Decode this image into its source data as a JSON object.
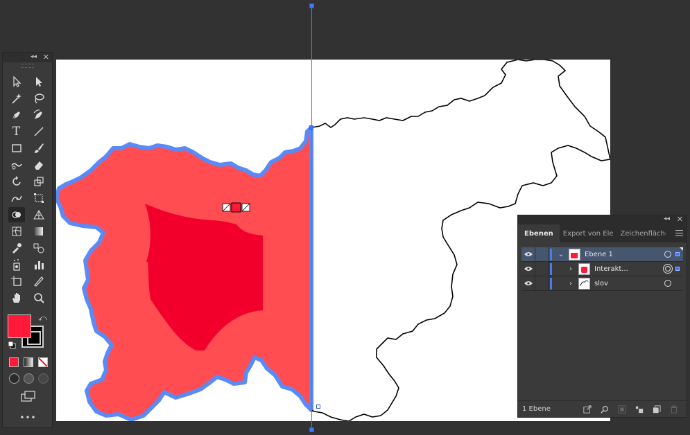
{
  "toolbar": {
    "tools": [
      [
        "selection-tool-icon",
        "direct-selection-tool-icon"
      ],
      [
        "magic-wand-tool-icon",
        "lasso-tool-icon"
      ],
      [
        "pen-tool-icon",
        "curvature-tool-icon"
      ],
      [
        "type-tool-icon",
        "line-segment-tool-icon"
      ],
      [
        "rectangle-tool-icon",
        "paintbrush-tool-icon"
      ],
      [
        "shaper-tool-icon",
        "eraser-tool-icon"
      ],
      [
        "rotate-tool-icon",
        "scale-tool-icon"
      ],
      [
        "puppet-warp-tool-icon",
        "free-transform-tool-icon"
      ],
      [
        "shape-builder-tool-icon",
        "perspective-grid-tool-icon"
      ],
      [
        "mesh-tool-icon",
        "gradient-tool-icon"
      ],
      [
        "eyedropper-tool-icon",
        "blend-tool-icon"
      ],
      [
        "symbol-sprayer-tool-icon",
        "column-graph-tool-icon"
      ],
      [
        "artboard-tool-icon",
        "slice-tool-icon"
      ],
      [
        "hand-tool-icon",
        "zoom-tool-icon"
      ]
    ],
    "type_glyph": "T",
    "fill_color": "#ff1a3a",
    "stroke_color": "#000000",
    "more": "•••"
  },
  "canvas": {
    "artboard_color": "#ffffff",
    "shape_fill": "#ff4d52",
    "shape_inner_fill": "#f2002b",
    "shape_outline": "#5a8af5",
    "selection_color": "#3e78ff"
  },
  "layers_panel": {
    "tabs": [
      "Ebenen",
      "Export von Ele",
      "Zeichenflächer"
    ],
    "active_tab": "Ebenen",
    "layers": [
      {
        "name": "Ebene 1",
        "expanded": true,
        "selected": true
      },
      {
        "name": "Interakt...",
        "expanded": false,
        "selected": false
      },
      {
        "name": "slov",
        "expanded": false,
        "selected": false
      }
    ],
    "layer_count": "1 Ebene"
  }
}
